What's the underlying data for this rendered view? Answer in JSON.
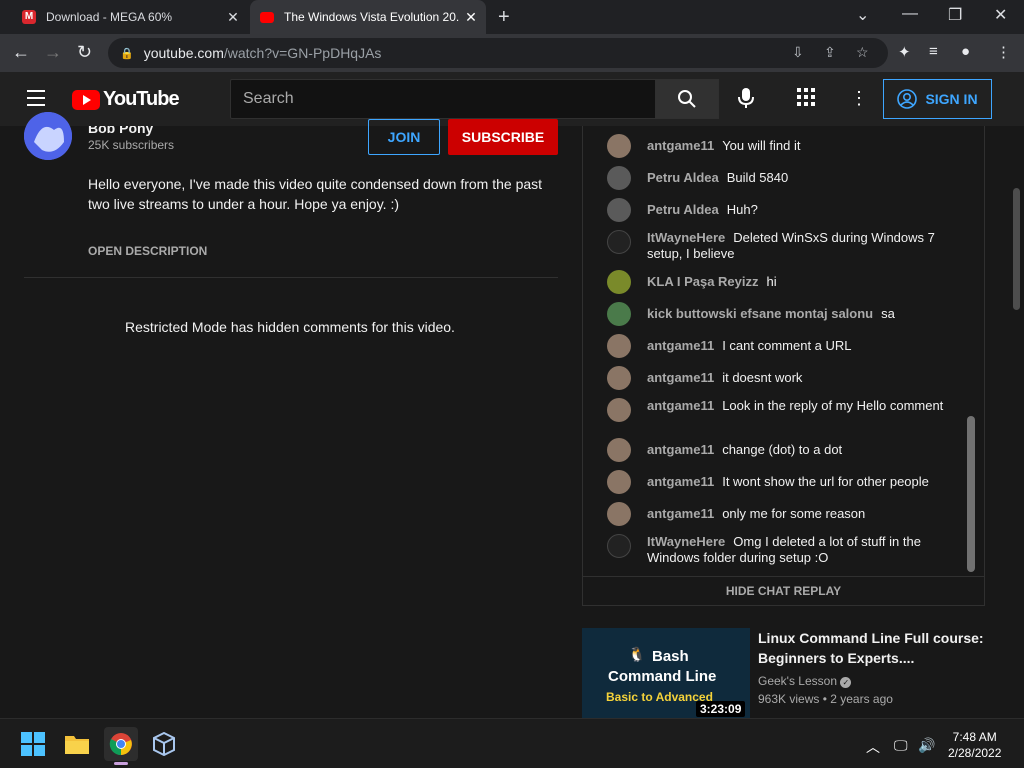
{
  "browser": {
    "tabs": [
      {
        "title": "Download - MEGA 60%",
        "favicon_color": "#d9272e"
      },
      {
        "title": "The Windows Vista Evolution 20...",
        "favicon_color": "#ff0000"
      }
    ],
    "url_host": "youtube.com",
    "url_path": "/watch?v=GN-PpDHqJAs"
  },
  "youtube": {
    "logo_text": "YouTube",
    "search_placeholder": "Search",
    "sign_in": "SIGN IN",
    "channel_name": "Bob Pony",
    "channel_subs": "25K subscribers",
    "join": "JOIN",
    "subscribe": "SUBSCRIBE",
    "description": "Hello everyone, I've made this video quite condensed down from the past two live streams to under a hour. Hope ya enjoy. :)",
    "open_description": "OPEN DESCRIPTION",
    "restricted": "Restricted Mode has hidden comments for this video.",
    "hide_chat": "HIDE CHAT REPLAY"
  },
  "chat": [
    {
      "author": "antgame11",
      "text": "You will find it",
      "avatar": "#8a7565"
    },
    {
      "author": "Petru Aldea",
      "text": "Build 5840",
      "avatar": "#5a5a5a"
    },
    {
      "author": "Petru Aldea",
      "text": "Huh?",
      "avatar": "#5a5a5a"
    },
    {
      "author": "ItWayneHere",
      "text": "Deleted WinSxS during Windows 7 setup, I believe",
      "avatar": "#222222"
    },
    {
      "author": "KLA I Paşa Reyizz",
      "text": "hi",
      "avatar": "#7a8a2a"
    },
    {
      "author": "kick buttowski efsane montaj salonu",
      "text": "sa",
      "avatar": "#4a7a4a"
    },
    {
      "author": "antgame11",
      "text": "I cant comment a URL",
      "avatar": "#8a7565"
    },
    {
      "author": "antgame11",
      "text": "it doesnt work",
      "avatar": "#8a7565"
    },
    {
      "author": "antgame11",
      "text": "Look in the reply of my Hello comment",
      "avatar": "#8a7565"
    },
    {
      "author": "antgame11",
      "text": "change (dot) to a dot",
      "avatar": "#8a7565"
    },
    {
      "author": "antgame11",
      "text": "It wont show the url for other people",
      "avatar": "#8a7565"
    },
    {
      "author": "antgame11",
      "text": "only me for some reason",
      "avatar": "#8a7565"
    },
    {
      "author": "ItWayneHere",
      "text": "Omg I deleted a lot of stuff in the Windows folder during setup :O",
      "avatar": "#222222"
    }
  ],
  "recommended": {
    "thumb_line1": "Bash",
    "thumb_line2": "Command Line",
    "thumb_line3": "Basic to Advanced",
    "duration": "3:23:09",
    "title": "Linux Command Line Full course: Beginners to Experts....",
    "channel": "Geek's Lesson",
    "meta": "963K views • 2 years ago"
  },
  "taskbar": {
    "time": "7:48 AM",
    "date": "2/28/2022"
  }
}
